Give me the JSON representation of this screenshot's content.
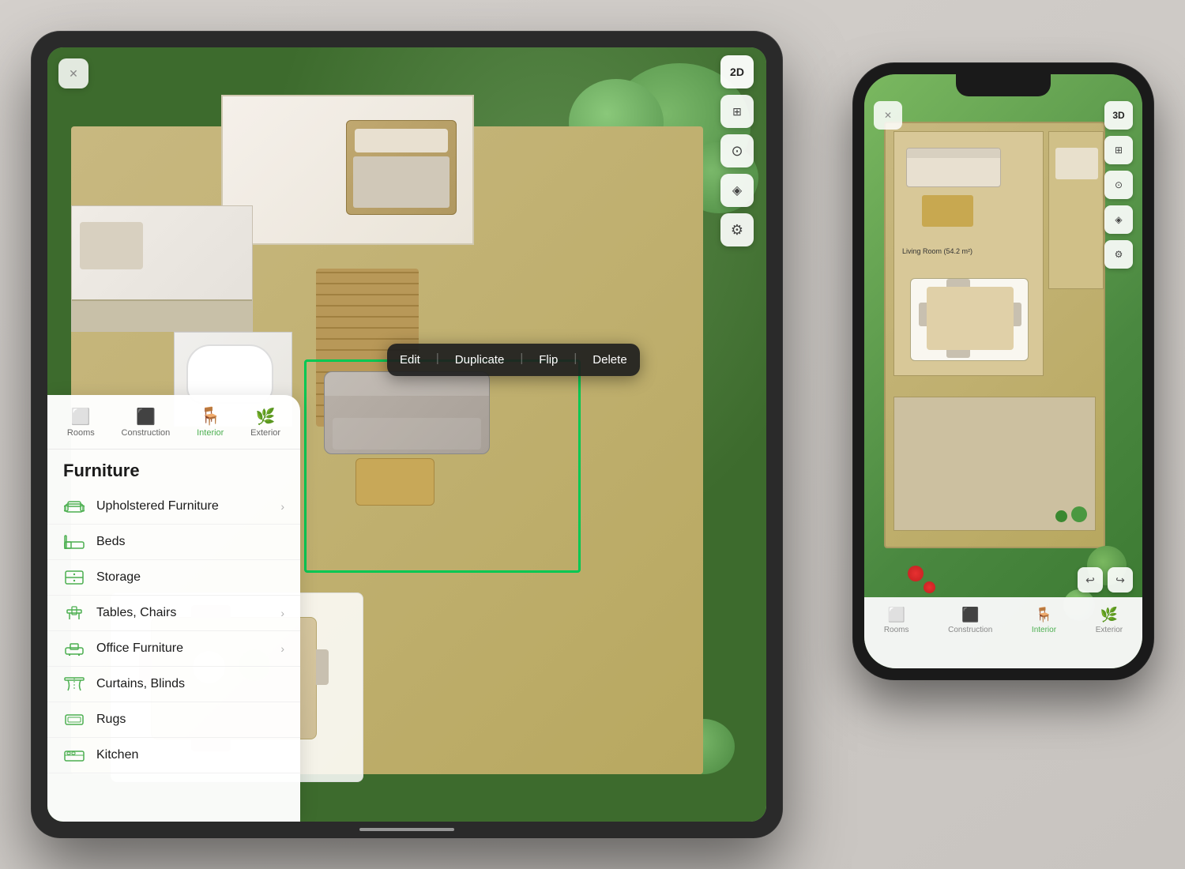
{
  "scene": {
    "background_color": "#e0ddd8"
  },
  "ipad": {
    "close_button": "✕",
    "toolbar": {
      "buttons": [
        {
          "label": "2D",
          "id": "2d-view",
          "active": true
        },
        {
          "label": "⊞",
          "id": "fullscreen",
          "active": false
        },
        {
          "label": "📷",
          "id": "camera",
          "active": false
        },
        {
          "label": "⊗",
          "id": "layers",
          "active": false
        },
        {
          "label": "⚙",
          "id": "settings",
          "active": false
        }
      ]
    },
    "context_menu": {
      "items": [
        "Edit",
        "Duplicate",
        "Flip",
        "Delete"
      ]
    },
    "panel": {
      "tabs": [
        {
          "id": "rooms",
          "label": "Rooms",
          "active": false
        },
        {
          "id": "construction",
          "label": "Construction",
          "active": false
        },
        {
          "id": "interior",
          "label": "Interior",
          "active": true
        },
        {
          "id": "exterior",
          "label": "Exterior",
          "active": false
        }
      ],
      "title": "Furniture",
      "items": [
        {
          "id": "upholstered",
          "label": "Upholstered Furniture",
          "has_chevron": true
        },
        {
          "id": "beds",
          "label": "Beds",
          "has_chevron": false
        },
        {
          "id": "storage",
          "label": "Storage",
          "has_chevron": false
        },
        {
          "id": "tables-chairs",
          "label": "Tables, Chairs",
          "has_chevron": true
        },
        {
          "id": "office",
          "label": "Office Furniture",
          "has_chevron": true
        },
        {
          "id": "curtains",
          "label": "Curtains, Blinds",
          "has_chevron": false
        },
        {
          "id": "rugs",
          "label": "Rugs",
          "has_chevron": false
        },
        {
          "id": "kitchen",
          "label": "Kitchen",
          "has_chevron": false
        }
      ]
    }
  },
  "iphone": {
    "view_mode": "3D",
    "close_button": "✕",
    "toolbar": {
      "buttons": [
        {
          "label": "3D",
          "id": "3d-view",
          "active": true
        },
        {
          "label": "⊞",
          "id": "fullscreen",
          "active": false
        },
        {
          "label": "📷",
          "id": "camera",
          "active": false
        },
        {
          "label": "⊗",
          "id": "layers",
          "active": false
        },
        {
          "label": "⚙",
          "id": "settings",
          "active": false
        }
      ]
    },
    "floor_plan": {
      "room_label": "Living Room (54.2 m²)"
    },
    "tabs": [
      {
        "id": "rooms",
        "label": "Rooms",
        "active": false
      },
      {
        "id": "construction",
        "label": "Construction",
        "active": false
      },
      {
        "id": "interior",
        "label": "Interior",
        "active": true
      },
      {
        "id": "exterior",
        "label": "Exterior",
        "active": false
      }
    ],
    "undo_label": "↩",
    "redo_label": "↪"
  }
}
